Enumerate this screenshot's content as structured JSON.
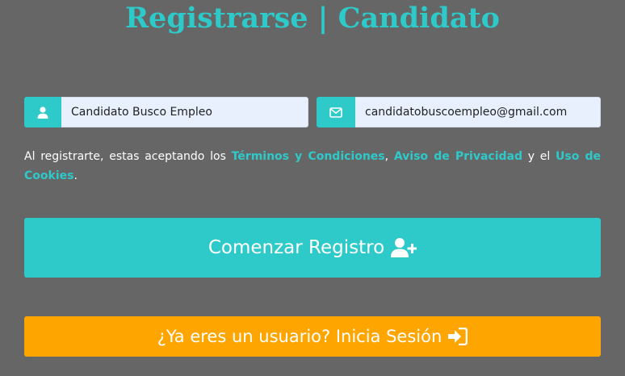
{
  "page": {
    "title": "Registrarse | Candidato"
  },
  "form": {
    "name_field": {
      "icon": "user-icon",
      "value": "Candidato Busco Empleo"
    },
    "email_field": {
      "icon": "envelope-icon",
      "value": "candidatobuscoempleo@gmail.com"
    }
  },
  "terms": {
    "prefix": "Al registrarte, estas aceptando los ",
    "terms_link": "Términos y Condiciones",
    "sep1": ", ",
    "privacy_link": "Aviso de Privacidad",
    "sep2": " y el ",
    "cookies_link": "Uso de Cookies",
    "suffix": "."
  },
  "buttons": {
    "register_label": "Comenzar Registro",
    "register_icon": "user-plus-icon",
    "login_label": "¿Ya eres un usuario? Inicia Sesión",
    "login_icon": "sign-in-icon"
  },
  "colors": {
    "background": "#666666",
    "accent": "#2ec9c9",
    "login_button": "#ffa500",
    "input_bg": "#e8f0fe"
  }
}
